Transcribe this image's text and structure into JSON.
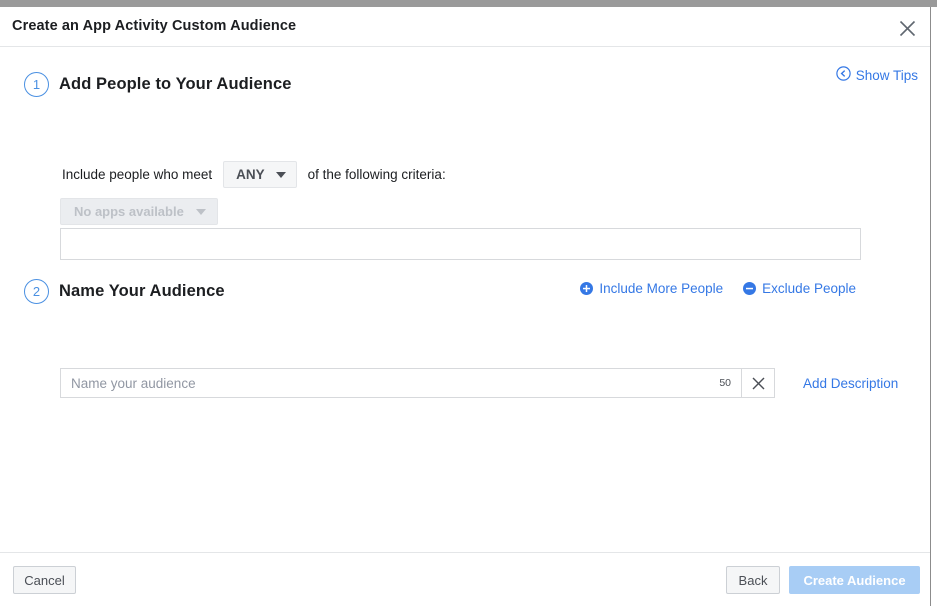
{
  "window": {
    "chrome_bar_color": "#9a9a9a"
  },
  "header": {
    "title": "Create an App Activity Custom Audience",
    "close_icon": "close-icon"
  },
  "tips": {
    "label": "Show Tips",
    "icon": "circled-chevron-left-icon"
  },
  "steps": [
    {
      "number": "1",
      "title": "Add People to Your Audience"
    },
    {
      "number": "2",
      "title": "Name Your Audience"
    }
  ],
  "criteria": {
    "prefix_text": "Include people who meet",
    "match_value": "ANY",
    "suffix_text": "of the following criteria:",
    "apps_select_value": "No apps available",
    "apps_select_disabled": true,
    "drop_area_text": ""
  },
  "people_links": [
    {
      "label": "Include More People",
      "icon": "plus-circle-icon"
    },
    {
      "label": "Exclude People",
      "icon": "minus-circle-icon"
    }
  ],
  "name_section": {
    "input_value": "",
    "placeholder": "Name your audience",
    "char_count": "50",
    "clear_icon": "close-icon",
    "add_description_label": "Add Description"
  },
  "footer": {
    "cancel_label": "Cancel",
    "back_label": "Back",
    "create_label": "Create Audience",
    "create_disabled": true
  },
  "colors": {
    "accent_blue": "#3578e5",
    "step_circle_blue": "#4a90e2",
    "disabled_button_blue": "#a8cdf5",
    "text_primary": "#1c1e21",
    "text_muted": "#bdc1c7",
    "border": "#d7d9dc"
  }
}
